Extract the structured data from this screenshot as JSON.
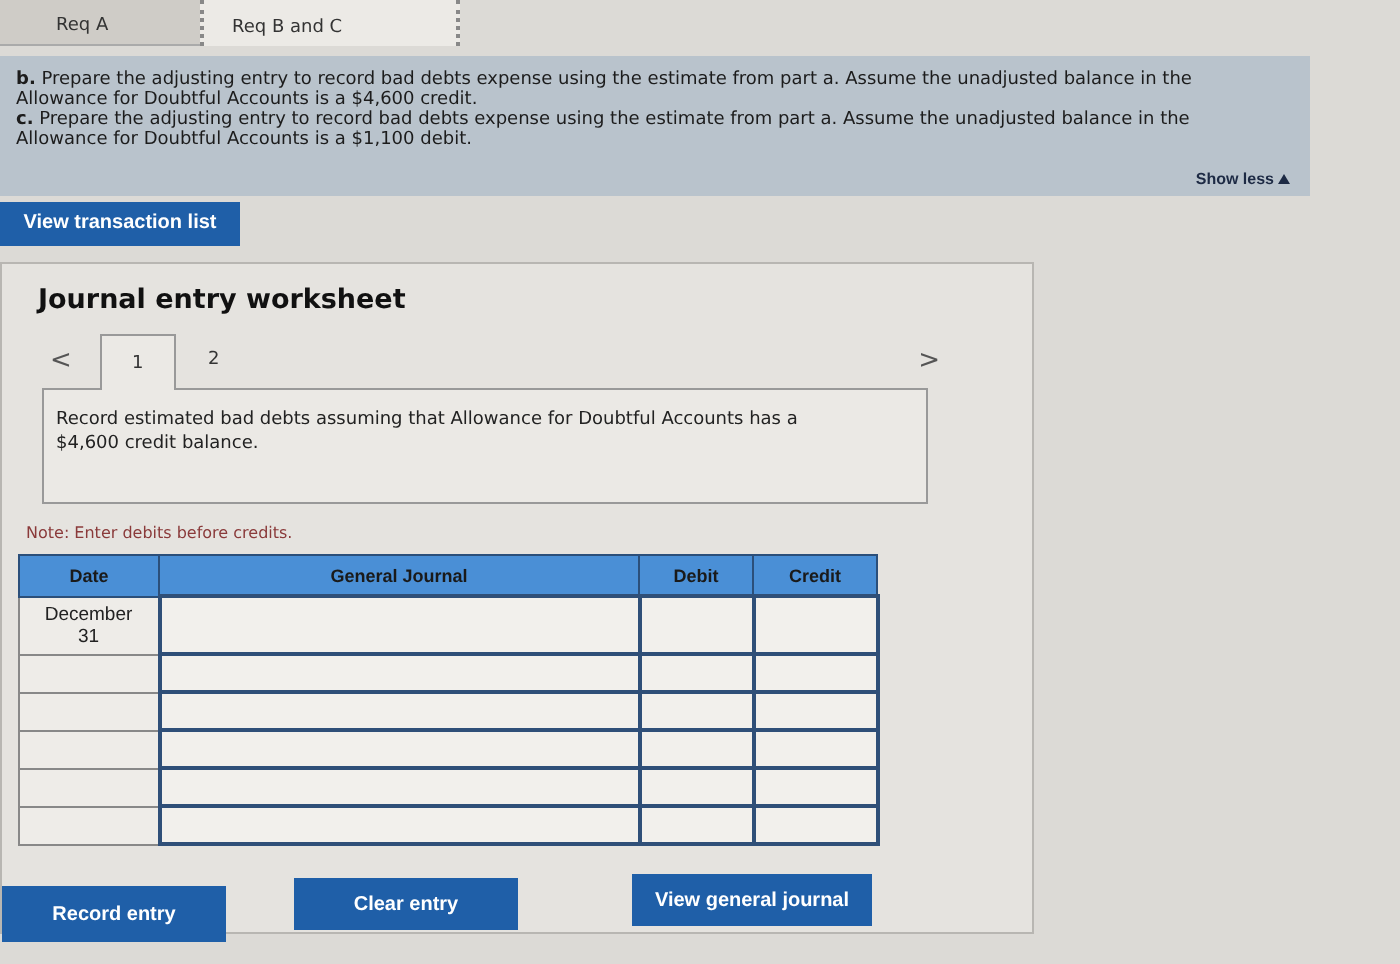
{
  "requirement_tabs": [
    {
      "label": "Req A",
      "selected": false
    },
    {
      "label": "Req B and C",
      "selected": true
    }
  ],
  "instructions": [
    "**b.** Prepare the adjusting entry to record bad debts expense using the estimate from part a. Assume the unadjusted balance in the Allowance for Doubtful Accounts is a $4,600 credit.",
    "**c.** Prepare the adjusting entry to record bad debts expense using the estimate from part a. Assume the unadjusted balance in the Allowance for Doubtful Accounts is a $1,100 debit."
  ],
  "show_less": "Show less",
  "transaction_button": "View transaction list",
  "worksheet": {
    "title": "Journal entry worksheet",
    "prev": "<",
    "next": ">",
    "entry_tabs": [
      {
        "label": "1",
        "selected": true
      },
      {
        "label": "2",
        "selected": false
      }
    ],
    "description": "Record estimated bad debts assuming that Allowance for Doubtful Accounts has a $4,600 credit balance.",
    "note": "Note: Enter debits before credits.",
    "table": {
      "columns": [
        "Date",
        "General Journal",
        "Debit",
        "Credit"
      ],
      "rows": [
        {
          "date": "December 31"
        },
        {},
        {},
        {},
        {},
        {}
      ]
    },
    "buttons": [
      "Record entry",
      "Clear entry",
      "View general journal"
    ]
  }
}
